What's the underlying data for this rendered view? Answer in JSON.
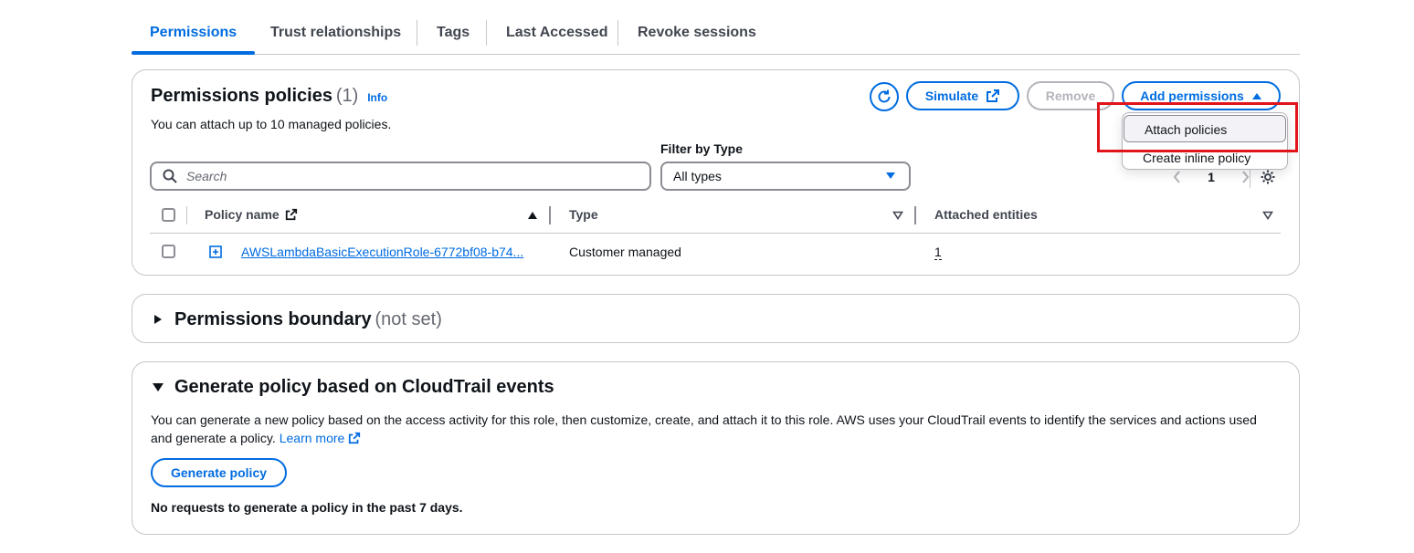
{
  "tabs": [
    {
      "label": "Permissions",
      "active": true
    },
    {
      "label": "Trust relationships"
    },
    {
      "label": "Tags"
    },
    {
      "label": "Last Accessed"
    },
    {
      "label": "Revoke sessions"
    }
  ],
  "permissions_policies": {
    "title": "Permissions policies",
    "count": "(1)",
    "info": "Info",
    "description": "You can attach up to 10 managed policies.",
    "simulate_label": "Simulate",
    "remove_label": "Remove",
    "add_permissions_label": "Add permissions",
    "dropdown": {
      "attach": "Attach policies",
      "create_inline": "Create inline policy"
    },
    "filter_label": "Filter by Type",
    "search_placeholder": "Search",
    "filter_value": "All types",
    "page_number": "1",
    "columns": {
      "policy_name": "Policy name",
      "type": "Type",
      "attached": "Attached entities"
    },
    "rows": [
      {
        "name": "AWSLambdaBasicExecutionRole-6772bf08-b74...",
        "type": "Customer managed",
        "attached": "1"
      }
    ]
  },
  "boundary": {
    "title": "Permissions boundary",
    "status": "(not set)"
  },
  "generate": {
    "title": "Generate policy based on CloudTrail events",
    "description": "You can generate a new policy based on the access activity for this role, then customize, create, and attach it to this role. AWS uses your CloudTrail events to identify the services and actions used",
    "description2": "and generate a policy.",
    "learn_more": "Learn more",
    "button": "Generate policy",
    "note": "No requests to generate a policy in the past 7 days."
  },
  "colors": {
    "accent": "#006ce0",
    "highlight": "#e0141a"
  }
}
